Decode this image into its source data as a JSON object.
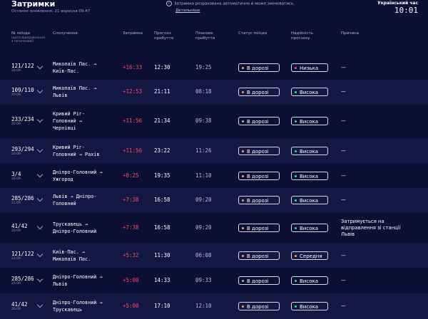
{
  "header": {
    "title": "Затримки",
    "updated": "Останнє оновлення: 21 вересня 09:47",
    "notice_line1": "Затримка розрахована автоматично й може змінюватись.",
    "notice_link": "Детальніше",
    "clock_label": "Український час",
    "clock": "10:01"
  },
  "columns": {
    "train": "№ поїзда",
    "train_sub": "(дата відправлення з початкової)",
    "route": "Сполучення",
    "delay": "Затримка",
    "forecast": "Прогноз прибуття",
    "planned": "Планове прибуття",
    "status": "Статус поїзда",
    "reliability": "Надійність прогнозу",
    "reason": "Причина"
  },
  "colors": {
    "dot_status": "#ffa64d",
    "dot_low": "#ff4d5e",
    "dot_high": "#3ddc84",
    "dot_mid": "#ffa64d"
  },
  "rows": [
    {
      "num": "121/122",
      "date": "20.09",
      "route": [
        "Миколаїв Пас. →",
        "Київ-Пас."
      ],
      "delay": "+16:33",
      "forecast": "12:30",
      "planned": "19:25",
      "status": "В дорозі",
      "rel": "Низька",
      "rel_color": "low",
      "reason": [
        "—"
      ]
    },
    {
      "num": "109/110",
      "date": "20.09",
      "route": [
        "Миколаїв Пас. →",
        "Львів"
      ],
      "delay": "+12:53",
      "forecast": "21:11",
      "planned": "08:18",
      "status": "В дорозі",
      "rel": "Висока",
      "rel_color": "high",
      "reason": [
        "—"
      ]
    },
    {
      "num": "233/234",
      "date": "20.09",
      "route": [
        "Кривий Ріг-",
        "Головний →",
        "Чернівці"
      ],
      "delay": "+11:56",
      "forecast": "21:34",
      "planned": "09:38",
      "status": "В дорозі",
      "rel": "Висока",
      "rel_color": "high",
      "reason": [
        "—"
      ]
    },
    {
      "num": "293/294",
      "date": "20.09",
      "route": [
        "Кривий Ріг-",
        "Головний → Рахів"
      ],
      "delay": "+11:56",
      "forecast": "23:22",
      "planned": "11:26",
      "status": "В дорозі",
      "rel": "Висока",
      "rel_color": "high",
      "reason": [
        "—"
      ]
    },
    {
      "num": "3/4",
      "date": "20.09",
      "route": [
        "Дніпро-Головний →",
        "Ужгород"
      ],
      "delay": "+8:25",
      "forecast": "19:35",
      "planned": "11:10",
      "status": "В дорозі",
      "rel": "Висока",
      "rel_color": "high",
      "reason": [
        "—"
      ]
    },
    {
      "num": "285/286",
      "date": "21.09",
      "route": [
        "Львів → Дніпро-",
        "Головний"
      ],
      "delay": "+7:38",
      "forecast": "16:58",
      "planned": "09:20",
      "status": "В дорозі",
      "rel": "Висока",
      "rel_color": "high",
      "reason": [
        "—"
      ]
    },
    {
      "num": "41/42",
      "date": "20.09",
      "route": [
        "Трускавець →",
        "Дніпро-Головний"
      ],
      "delay": "+7:38",
      "forecast": "16:58",
      "planned": "09:20",
      "status": "В дорозі",
      "rel": "Висока",
      "rel_color": "high",
      "reason": [
        "Затримується на",
        "відправлення зі станції",
        "Львів"
      ]
    },
    {
      "num": "121/122",
      "date": "21.09",
      "route": [
        "Київ-Пас. →",
        "Миколаїв Пас."
      ],
      "delay": "+5:32",
      "forecast": "11:30",
      "planned": "06:08",
      "status": "В дорозі",
      "rel": "Середня",
      "rel_color": "mid",
      "reason": [
        "—"
      ]
    },
    {
      "num": "285/286",
      "date": "20.09",
      "route": [
        "Дніпро-Головний →",
        "Львів"
      ],
      "delay": "+5:00",
      "forecast": "14:33",
      "planned": "09:33",
      "status": "В дорозі",
      "rel": "Висока",
      "rel_color": "high",
      "reason": [
        "—"
      ]
    },
    {
      "num": "41/42",
      "date": "20.09",
      "route": [
        "Дніпро-Головний →",
        "Трускавець"
      ],
      "delay": "+5:00",
      "forecast": "17:10",
      "planned": "12:10",
      "status": "В дорозі",
      "rel": "Висока",
      "rel_color": "high",
      "reason": [
        "—"
      ]
    }
  ]
}
